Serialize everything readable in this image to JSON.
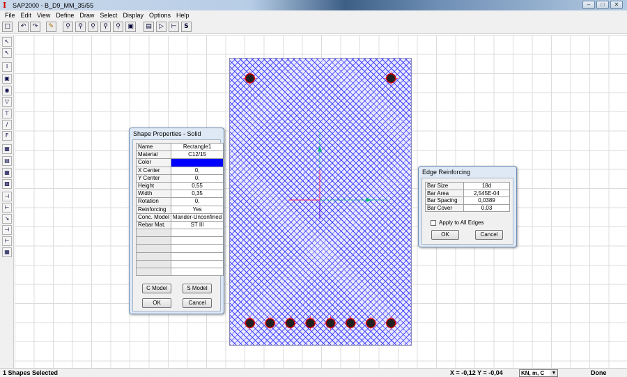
{
  "window": {
    "title": "SAP2000 - B_D9_MM_35/55",
    "app_icon": "I",
    "controls": [
      "–",
      "□",
      "✕"
    ]
  },
  "menu": [
    "File",
    "Edit",
    "View",
    "Define",
    "Draw",
    "Select",
    "Display",
    "Options",
    "Help"
  ],
  "toolbar_icons": [
    "new-icon",
    "undo-icon",
    "redo-icon",
    "pencil-icon",
    "zoom-window-icon",
    "zoom-in-icon",
    "zoom-out-icon",
    "zoom-previous-icon",
    "zoom-icon",
    "zoom-extents-icon",
    "section-icon",
    "polygon-icon",
    "axes-icon",
    "dollar-icon"
  ],
  "left_tools": [
    "pointer-icon",
    "reshape-icon",
    "draw-i-section-icon",
    "draw-rectangle-icon",
    "draw-circle-icon",
    "draw-polygon-icon",
    "draw-caisson-icon",
    "draw-line-icon",
    "draw-f-icon",
    "reinforcing-icon",
    "rebar-icon",
    "stress-strain-icon",
    "hatch-icon",
    "align-left-icon",
    "align-center-icon",
    "align-right-icon",
    "align-h-icon",
    "align-end-icon",
    "grid-icon"
  ],
  "shape_properties": {
    "title": "Shape Properties - Solid",
    "rows": [
      {
        "key": "Name",
        "value": "Rectangle1"
      },
      {
        "key": "Material",
        "value": "C12/15"
      },
      {
        "key": "Color",
        "value": ""
      },
      {
        "key": "X Center",
        "value": "0,"
      },
      {
        "key": "Y Center",
        "value": "0,"
      },
      {
        "key": "Height",
        "value": "0,55"
      },
      {
        "key": "Width",
        "value": "0,35"
      },
      {
        "key": "Rotation",
        "value": "0,"
      },
      {
        "key": "Reinforcing",
        "value": "Yes"
      },
      {
        "key": "Conc. Model",
        "value": "Mander-Unconfined"
      },
      {
        "key": "Rebar Mat.",
        "value": "ST III"
      }
    ],
    "c_model_label": "C Model",
    "s_model_label": "S Model",
    "ok_label": "OK",
    "cancel_label": "Cancel",
    "color": "#0000ff"
  },
  "edge_reinforcing": {
    "title": "Edge Reinforcing",
    "rows": [
      {
        "key": "Bar Size",
        "value": "18d"
      },
      {
        "key": "Bar Area",
        "value": "2,545E-04"
      },
      {
        "key": "Bar Spacing",
        "value": "0,0389"
      },
      {
        "key": "Bar Cover",
        "value": "0,03"
      }
    ],
    "apply_all_label": "Apply to All Edges",
    "apply_all_checked": false,
    "ok_label": "OK",
    "cancel_label": "Cancel"
  },
  "section": {
    "top_bars": 2,
    "bottom_bars": 8,
    "hatch_color": "#3a3aff",
    "bar_color": "#cc0000"
  },
  "status": {
    "selection": "1 Shapes Selected",
    "coords": "X = -0,12    Y = -0,04",
    "units": "KN, m, C",
    "state": "Done"
  }
}
